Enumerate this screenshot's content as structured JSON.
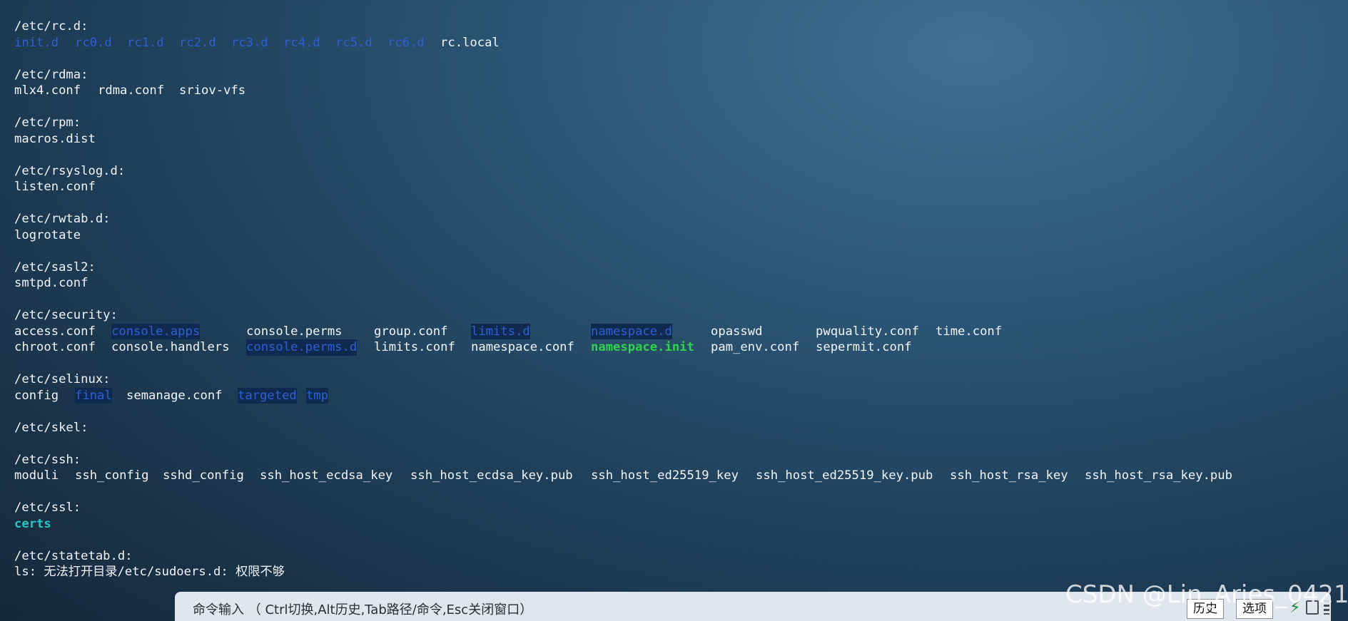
{
  "terminal": {
    "lines": [
      [
        {
          "text": "/etc/rc.d:",
          "style": "plain"
        }
      ],
      [
        {
          "text": "init.d",
          "style": "dir"
        },
        {
          "text": "rc0.d",
          "style": "dir"
        },
        {
          "text": "rc1.d",
          "style": "dir"
        },
        {
          "text": "rc2.d",
          "style": "dir"
        },
        {
          "text": "rc3.d",
          "style": "dir"
        },
        {
          "text": "rc4.d",
          "style": "dir"
        },
        {
          "text": "rc5.d",
          "style": "dir"
        },
        {
          "text": "rc6.d",
          "style": "dir"
        },
        {
          "text": "rc.local",
          "style": "plain"
        }
      ],
      [],
      [
        {
          "text": "/etc/rdma:",
          "style": "plain"
        }
      ],
      [
        {
          "text": "mlx4.conf",
          "style": "plain"
        },
        {
          "text": "rdma.conf",
          "style": "plain"
        },
        {
          "text": "sriov-vfs",
          "style": "plain"
        }
      ],
      [],
      [
        {
          "text": "/etc/rpm:",
          "style": "plain"
        }
      ],
      [
        {
          "text": "macros.dist",
          "style": "plain"
        }
      ],
      [],
      [
        {
          "text": "/etc/rsyslog.d:",
          "style": "plain"
        }
      ],
      [
        {
          "text": "listen.conf",
          "style": "plain"
        }
      ],
      [],
      [
        {
          "text": "/etc/rwtab.d:",
          "style": "plain"
        }
      ],
      [
        {
          "text": "logrotate",
          "style": "plain"
        }
      ],
      [],
      [
        {
          "text": "/etc/sasl2:",
          "style": "plain"
        }
      ],
      [
        {
          "text": "smtpd.conf",
          "style": "plain"
        }
      ],
      [],
      [
        {
          "text": "/etc/security:",
          "style": "plain"
        }
      ],
      [
        {
          "text": "access.conf",
          "style": "plain"
        },
        {
          "text": "console.apps",
          "style": "dir-hl"
        },
        {
          "text": "console.perms",
          "style": "plain"
        },
        {
          "text": "group.conf",
          "style": "plain"
        },
        {
          "text": "limits.d",
          "style": "dir-hl"
        },
        {
          "text": "namespace.d",
          "style": "dir-hl"
        },
        {
          "text": "opasswd",
          "style": "plain"
        },
        {
          "text": "pwquality.conf",
          "style": "plain"
        },
        {
          "text": "time.conf",
          "style": "plain"
        }
      ],
      [
        {
          "text": "chroot.conf",
          "style": "plain"
        },
        {
          "text": "console.handlers",
          "style": "plain"
        },
        {
          "text": "console.perms.d",
          "style": "dir-hl"
        },
        {
          "text": "limits.conf",
          "style": "plain"
        },
        {
          "text": "namespace.conf",
          "style": "plain"
        },
        {
          "text": "namespace.init",
          "style": "exec"
        },
        {
          "text": "pam_env.conf",
          "style": "plain"
        },
        {
          "text": "sepermit.conf",
          "style": "plain"
        }
      ],
      [],
      [
        {
          "text": "/etc/selinux:",
          "style": "plain"
        }
      ],
      [
        {
          "text": "config",
          "style": "plain"
        },
        {
          "text": "final",
          "style": "dir-hl"
        },
        {
          "text": "semanage.conf",
          "style": "plain"
        },
        {
          "text": "targeted",
          "style": "dir-hl"
        },
        {
          "text": "tmp",
          "style": "dir-hl"
        }
      ],
      [],
      [
        {
          "text": "/etc/skel:",
          "style": "plain"
        }
      ],
      [],
      [
        {
          "text": "/etc/ssh:",
          "style": "plain"
        }
      ],
      [
        {
          "text": "moduli",
          "style": "plain"
        },
        {
          "text": "ssh_config",
          "style": "plain"
        },
        {
          "text": "sshd_config",
          "style": "plain"
        },
        {
          "text": "ssh_host_ecdsa_key",
          "style": "plain"
        },
        {
          "text": "ssh_host_ecdsa_key.pub",
          "style": "plain"
        },
        {
          "text": "ssh_host_ed25519_key",
          "style": "plain"
        },
        {
          "text": "ssh_host_ed25519_key.pub",
          "style": "plain"
        },
        {
          "text": "ssh_host_rsa_key",
          "style": "plain"
        },
        {
          "text": "ssh_host_rsa_key.pub",
          "style": "plain"
        }
      ],
      [],
      [
        {
          "text": "/etc/ssl:",
          "style": "plain"
        }
      ],
      [
        {
          "text": "certs",
          "style": "link"
        }
      ],
      [],
      [
        {
          "text": "/etc/statetab.d:",
          "style": "plain"
        }
      ],
      [
        {
          "text": "ls: 无法打开目录/etc/sudoers.d: 权限不够",
          "style": "plain"
        }
      ]
    ]
  },
  "cmdbar": {
    "hint": "命令输入 （ Ctrl切换,Alt历史,Tab路径/命令,Esc关闭窗口）",
    "history_label": "历史",
    "options_label": "选项"
  },
  "watermark": "CSDN @Lin_Aries_0421"
}
